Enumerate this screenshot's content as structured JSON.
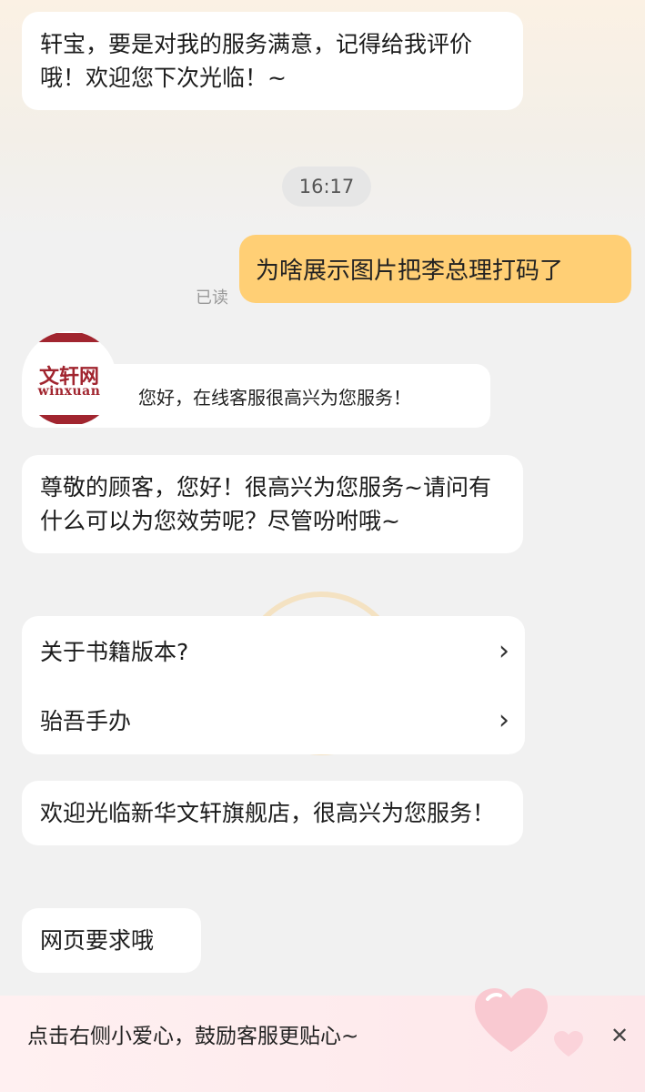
{
  "messages": {
    "m1": "轩宝，要是对我的服务满意，记得给我评价哦！欢迎您下次光临！~",
    "timestamp": "16:17",
    "outgoing": "为啥展示图片把李总理打码了",
    "read_status": "已读",
    "greeting": "您好，在线客服很高兴为您服务！",
    "m2": "尊敬的顾客，您好！很高兴为您服务~请问有什么可以为您效劳呢？尽管吩咐哦~",
    "m4": "欢迎光临新华文轩旗舰店，很高兴为您服务！",
    "m5": "网页要求哦"
  },
  "avatar": {
    "logo_cn": "文轩网",
    "logo_en": "winxuan"
  },
  "menu": {
    "items": [
      {
        "label": "关于书籍版本?",
        "icon": "chevron-right-icon"
      },
      {
        "label": "骀吾手办",
        "icon": "chevron-right-icon"
      }
    ]
  },
  "footer": {
    "text": "点击右侧小爱心，鼓励客服更贴心~",
    "close_icon": "close-icon",
    "heart_icon": "heart-icon"
  },
  "colors": {
    "outgoing_bubble": "#ffcf75",
    "brand_red": "#a1252f",
    "background": "#f1f1f1"
  }
}
